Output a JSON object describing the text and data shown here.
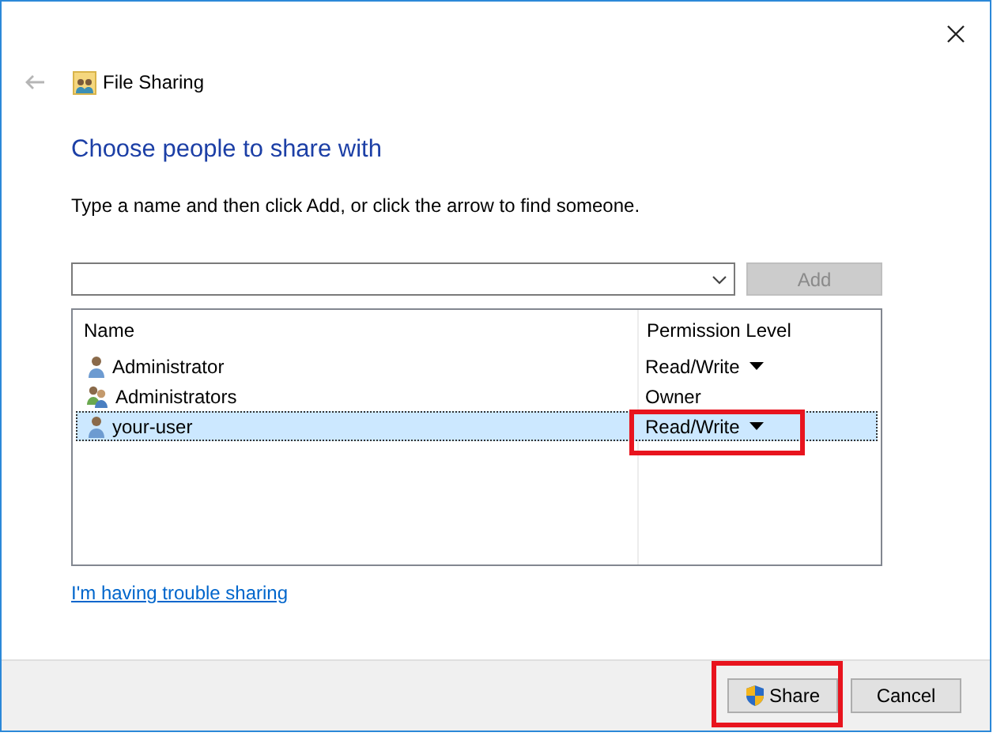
{
  "window": {
    "title": "File Sharing"
  },
  "heading": "Choose people to share with",
  "instruction": "Type a name and then click Add, or click the arrow to find someone.",
  "name_field": {
    "add_button": {
      "label": "Add",
      "disabled": true
    }
  },
  "table": {
    "columns": [
      "Name",
      "Permission Level"
    ],
    "rows": [
      {
        "name": "Administrator",
        "kind": "user",
        "permission": "Read/Write",
        "has_menu": true,
        "selected": false,
        "highlighted": false
      },
      {
        "name": "Administrators",
        "kind": "group",
        "permission": "Owner",
        "has_menu": false,
        "selected": false,
        "highlighted": false
      },
      {
        "name": "your-user",
        "kind": "user",
        "permission": "Read/Write",
        "has_menu": true,
        "selected": true,
        "highlighted": true
      }
    ]
  },
  "help_link": "I'm having trouble sharing",
  "buttons": [
    {
      "label": "Share",
      "kind": "shield",
      "highlighted": true
    },
    {
      "label": "Cancel",
      "kind": "plain",
      "highlighted": false
    }
  ]
}
